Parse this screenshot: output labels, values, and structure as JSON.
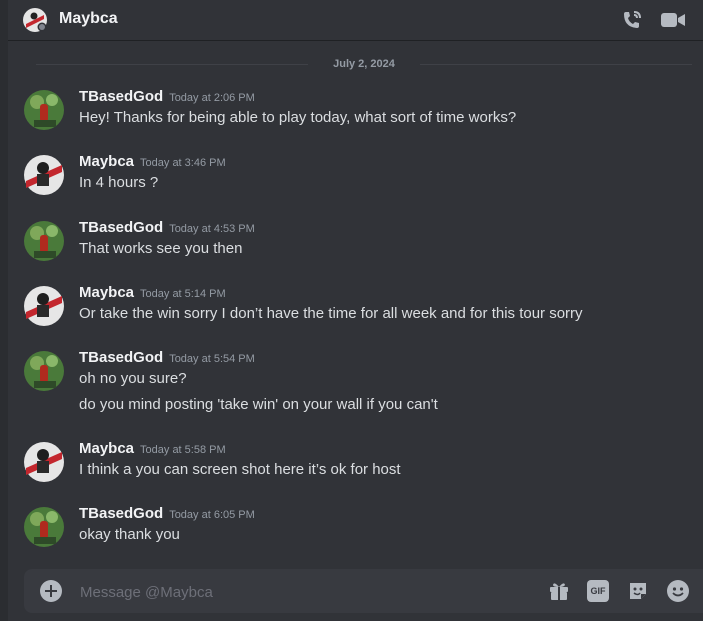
{
  "header": {
    "title": "Maybca",
    "call_icon": "phone-call-icon",
    "video_icon": "video-camera-icon"
  },
  "divider": {
    "date": "July 2, 2024"
  },
  "messages": [
    {
      "author": "TBasedGod",
      "time": "Today at 2:06 PM",
      "lines": [
        "Hey! Thanks for being able to play today, what sort of time works?"
      ]
    },
    {
      "author": "Maybca",
      "time": "Today at 3:46 PM",
      "lines": [
        "In 4 hours ?"
      ]
    },
    {
      "author": "TBasedGod",
      "time": "Today at 4:53 PM",
      "lines": [
        "That works see you then"
      ]
    },
    {
      "author": "Maybca",
      "time": "Today at 5:14 PM",
      "lines": [
        "Or take the win sorry I don’t have the time for all week and for this tour sorry"
      ]
    },
    {
      "author": "TBasedGod",
      "time": "Today at 5:54 PM",
      "lines": [
        "oh no you sure?",
        "do you mind posting 'take win' on your wall if you can't"
      ]
    },
    {
      "author": "Maybca",
      "time": "Today at 5:58 PM",
      "lines": [
        "I think a you can screen shot here it’s ok for host"
      ]
    },
    {
      "author": "TBasedGod",
      "time": "Today at 6:05 PM",
      "lines": [
        "okay thank you"
      ]
    }
  ],
  "composer": {
    "placeholder": "Message @Maybca",
    "gif_label": "GIF",
    "icons": [
      "add-circle-icon",
      "gift-icon",
      "gif-icon",
      "sticker-icon",
      "emoji-icon"
    ]
  },
  "colors": {
    "background": "#313338",
    "composer": "#383a40",
    "text": "#dbdee1",
    "muted": "#949ba4",
    "author": "#f2f3f5"
  }
}
